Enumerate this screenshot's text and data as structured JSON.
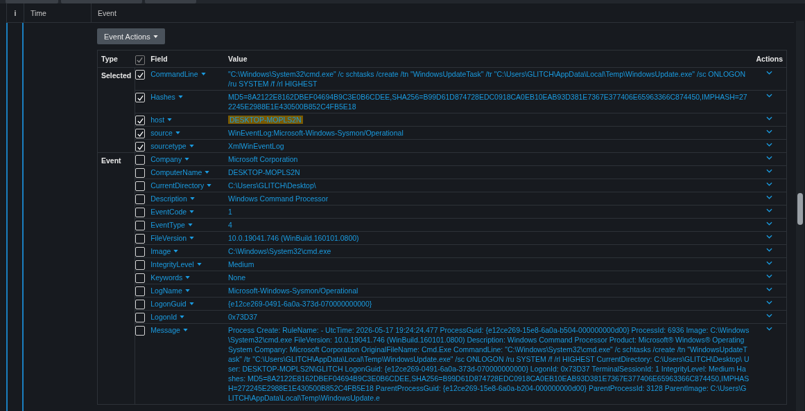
{
  "columns": [
    {
      "label": "i"
    },
    {
      "label": "Time"
    },
    {
      "label": "Event"
    }
  ],
  "event": {
    "actions_button": "Event Actions",
    "table": {
      "columns": [
        "Type",
        "Field",
        "Value",
        "Actions"
      ],
      "all_checked": true,
      "groups": [
        {
          "type": "Selected",
          "rows": [
            {
              "field": "CommandLine",
              "value": "\"C:\\Windows\\System32\\cmd.exe\" /c schtasks /create /tn \"WindowsUpdateTask\" /tr \"C:\\Users\\GLITCH\\AppData\\Local\\Temp\\WindowsUpdate.exe\" /sc ONLOGON /ru SYSTEM /f /rl HIGHEST",
              "checked": true,
              "highlighted": false
            },
            {
              "field": "Hashes",
              "value": "MD5=8A2122E8162DBEF04694B9C3E0B6CDEE,SHA256=B99D61D874728EDC0918CA0EB10EAB93D381E7367E377406E65963366C874450,IMPHASH=272245E2988E1E430500B852C4FB5E18",
              "checked": true,
              "highlighted": false
            },
            {
              "field": "host",
              "value": "DESKTOP-MOPLS2N",
              "checked": true,
              "highlighted": true
            },
            {
              "field": "source",
              "value": "WinEventLog:Microsoft-Windows-Sysmon/Operational",
              "checked": true,
              "highlighted": false
            },
            {
              "field": "sourcetype",
              "value": "XmlWinEventLog",
              "checked": true,
              "highlighted": false
            }
          ]
        },
        {
          "type": "Event",
          "rows": [
            {
              "field": "Company",
              "value": "Microsoft Corporation",
              "checked": false,
              "highlighted": false
            },
            {
              "field": "ComputerName",
              "value": "DESKTOP-MOPLS2N",
              "checked": false,
              "highlighted": false
            },
            {
              "field": "CurrentDirectory",
              "value": "C:\\Users\\GLITCH\\Desktop\\",
              "checked": false,
              "highlighted": false
            },
            {
              "field": "Description",
              "value": "Windows Command Processor",
              "checked": false,
              "highlighted": false
            },
            {
              "field": "EventCode",
              "value": "1",
              "checked": false,
              "highlighted": false
            },
            {
              "field": "EventType",
              "value": "4",
              "checked": false,
              "highlighted": false
            },
            {
              "field": "FileVersion",
              "value": "10.0.19041.746 (WinBuild.160101.0800)",
              "checked": false,
              "highlighted": false
            },
            {
              "field": "Image",
              "value": "C:\\Windows\\System32\\cmd.exe",
              "checked": false,
              "highlighted": false
            },
            {
              "field": "IntegrityLevel",
              "value": "Medium",
              "checked": false,
              "highlighted": false
            },
            {
              "field": "Keywords",
              "value": "None",
              "checked": false,
              "highlighted": false
            },
            {
              "field": "LogName",
              "value": "Microsoft-Windows-Sysmon/Operational",
              "checked": false,
              "highlighted": false
            },
            {
              "field": "LogonGuid",
              "value": "{e12ce269-0491-6a0a-373d-070000000000}",
              "checked": false,
              "highlighted": false
            },
            {
              "field": "LogonId",
              "value": "0x73D37",
              "checked": false,
              "highlighted": false
            },
            {
              "field": "Message",
              "value": "Process Create: RuleName: - UtcTime: 2026-05-17 19:24:24.477 ProcessGuid: {e12ce269-15e8-6a0a-b504-000000000d00} ProcessId: 6936 Image: C:\\Windows\\System32\\cmd.exe FileVersion: 10.0.19041.746 (WinBuild.160101.0800) Description: Windows Command Processor Product: Microsoft® Windows® Operating System Company: Microsoft Corporation OriginalFileName: Cmd.Exe CommandLine: \"C:\\Windows\\System32\\cmd.exe\" /c schtasks /create /tn \"WindowsUpdateTask\" /tr \"C:\\Users\\GLITCH\\AppData\\Local\\Temp\\WindowsUpdate.exe\" /sc ONLOGON /ru SYSTEM /f /rl HIGHEST CurrentDirectory: C:\\Users\\GLITCH\\Desktop\\ User: DESKTOP-MOPLS2N\\GLITCH LogonGuid: {e12ce269-0491-6a0a-373d-070000000000} LogonId: 0x73D37 TerminalSessionId: 1 IntegrityLevel: Medium Hashes: MD5=8A2122E8162DBEF04694B9C3E0B6CDEE,SHA256=B99D61D874728EDC0918CA0EB10EAB93D381E7367E377406E65963366C874450,IMPHASH=272245E2988E1E430500B852C4FB5E18 ParentProcessGuid: {e12ce269-15e8-6a0a-b204-000000000d00} ParentProcessId: 3128 ParentImage: C:\\Users\\GLITCH\\AppData\\Local\\Temp\\WindowsUpdate.e",
              "checked": false,
              "highlighted": false
            }
          ]
        }
      ]
    }
  }
}
